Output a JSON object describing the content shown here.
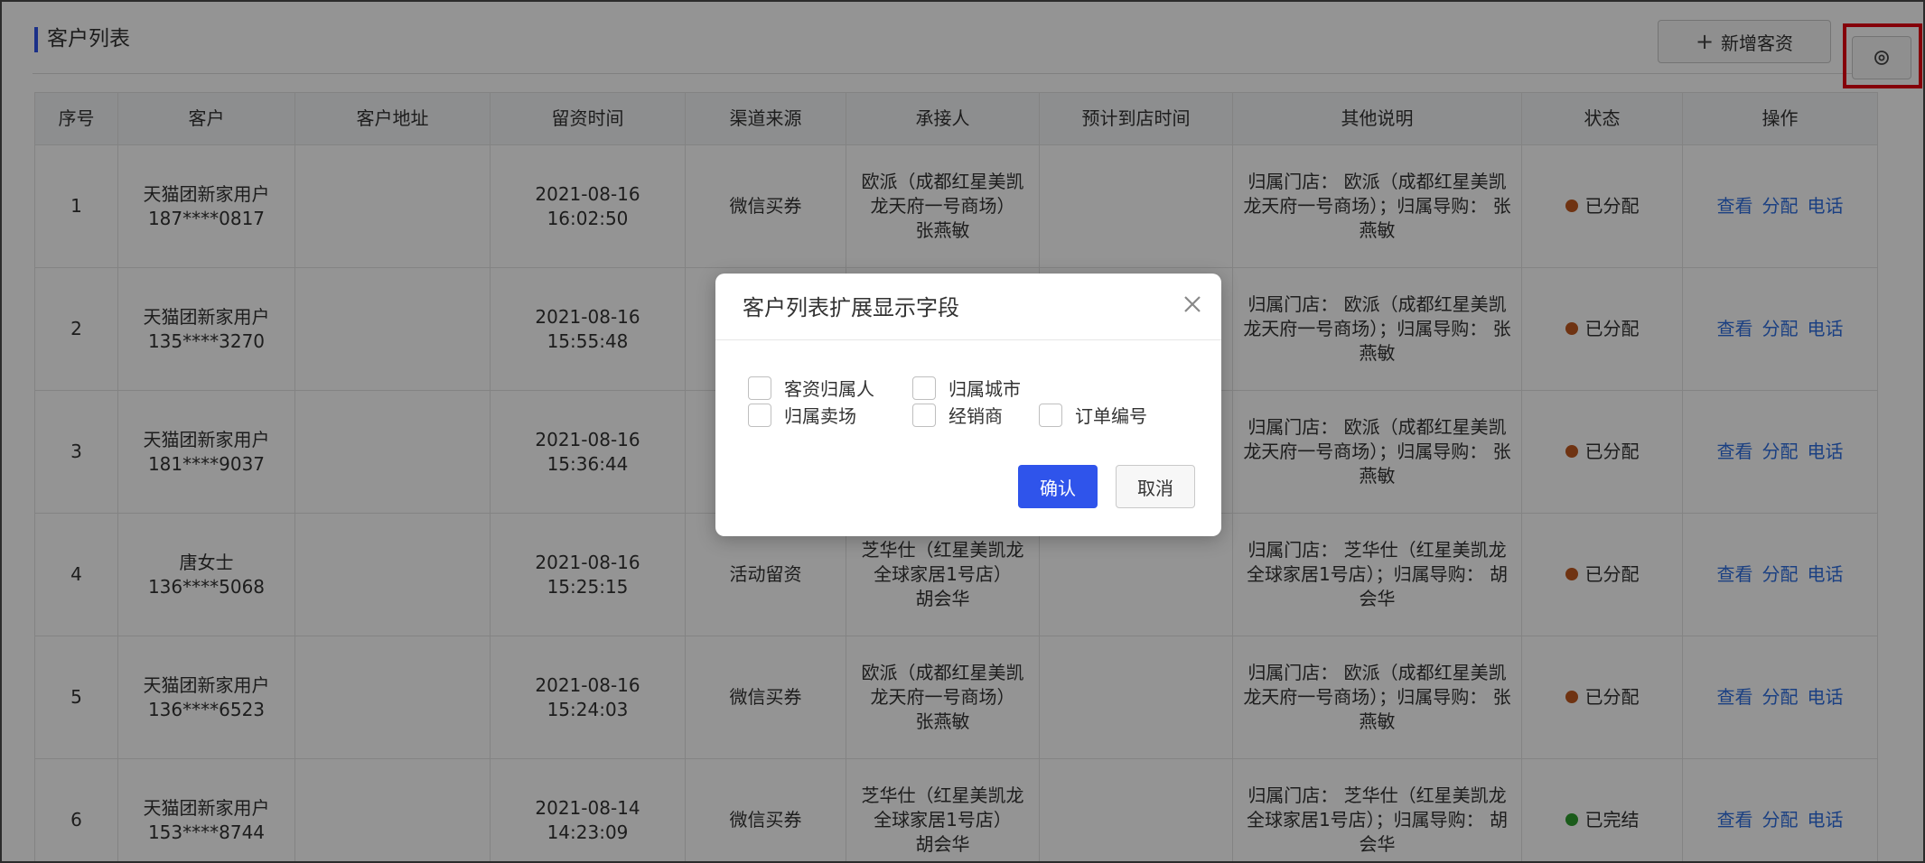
{
  "header": {
    "title": "客户列表",
    "add_label": "新增客资",
    "add_icon": "plus-icon",
    "settings_icon": "settings-icon"
  },
  "table": {
    "columns": [
      "序号",
      "客户",
      "客户地址",
      "留资时间",
      "渠道来源",
      "承接人",
      "预计到店时间",
      "其他说明",
      "状态",
      "操作"
    ],
    "actions": [
      "查看",
      "分配",
      "电话"
    ],
    "rows": [
      {
        "no": "1",
        "customer_name": "天猫团新家用户",
        "customer_phone": "187****0817",
        "address": "",
        "time_date": "2021-08-16",
        "time_clock": "16:02:50",
        "channel": "微信买券",
        "receiver_store": "欧派（成都红星美凯龙天府一号商场）",
        "receiver_name": "张燕敏",
        "visit_time": "",
        "note": "归属门店： 欧派（成都红星美凯龙天府一号商场）；归属导购： 张燕敏",
        "status": "已分配",
        "status_color": "#c0581f"
      },
      {
        "no": "2",
        "customer_name": "天猫团新家用户",
        "customer_phone": "135****3270",
        "address": "",
        "time_date": "2021-08-16",
        "time_clock": "15:55:48",
        "channel": "",
        "receiver_store": "",
        "receiver_name": "",
        "visit_time": "",
        "note": "归属门店： 欧派（成都红星美凯龙天府一号商场）；归属导购： 张燕敏",
        "status": "已分配",
        "status_color": "#c0581f"
      },
      {
        "no": "3",
        "customer_name": "天猫团新家用户",
        "customer_phone": "181****9037",
        "address": "",
        "time_date": "2021-08-16",
        "time_clock": "15:36:44",
        "channel": "",
        "receiver_store": "",
        "receiver_name": "",
        "visit_time": "",
        "note": "归属门店： 欧派（成都红星美凯龙天府一号商场）；归属导购： 张燕敏",
        "status": "已分配",
        "status_color": "#c0581f"
      },
      {
        "no": "4",
        "customer_name": "唐女士",
        "customer_phone": "136****5068",
        "address": "",
        "time_date": "2021-08-16",
        "time_clock": "15:25:15",
        "channel": "活动留资",
        "receiver_store": "芝华仕（红星美凯龙全球家居1号店）",
        "receiver_name": "胡会华",
        "visit_time": "",
        "note": "归属门店： 芝华仕（红星美凯龙全球家居1号店）；归属导购： 胡会华",
        "status": "已分配",
        "status_color": "#c0581f"
      },
      {
        "no": "5",
        "customer_name": "天猫团新家用户",
        "customer_phone": "136****6523",
        "address": "",
        "time_date": "2021-08-16",
        "time_clock": "15:24:03",
        "channel": "微信买券",
        "receiver_store": "欧派（成都红星美凯龙天府一号商场）",
        "receiver_name": "张燕敏",
        "visit_time": "",
        "note": "归属门店： 欧派（成都红星美凯龙天府一号商场）；归属导购： 张燕敏",
        "status": "已分配",
        "status_color": "#c0581f"
      },
      {
        "no": "6",
        "customer_name": "天猫团新家用户",
        "customer_phone": "153****8744",
        "address": "",
        "time_date": "2021-08-14",
        "time_clock": "14:23:09",
        "channel": "微信买券",
        "receiver_store": "芝华仕（红星美凯龙全球家居1号店）",
        "receiver_name": "胡会华",
        "visit_time": "",
        "note": "归属门店： 芝华仕（红星美凯龙全球家居1号店）；归属导购： 胡会华",
        "status": "已完结",
        "status_color": "#2e9d2e"
      }
    ]
  },
  "modal": {
    "title": "客户列表扩展显示字段",
    "close_icon": "close-icon",
    "options": [
      "客资归属人",
      "归属城市",
      "归属卖场",
      "经销商",
      "订单编号"
    ],
    "confirm_label": "确认",
    "cancel_label": "取消"
  },
  "colors": {
    "primary": "#2f54eb",
    "highlight": "#e60012",
    "link": "#2f6fe0"
  }
}
